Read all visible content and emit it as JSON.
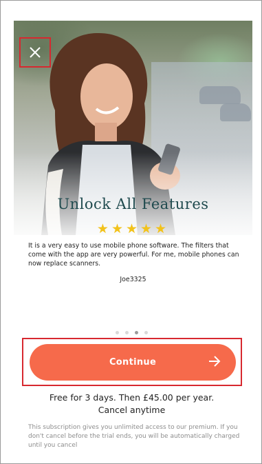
{
  "paywall": {
    "title": "Unlock All Features",
    "rating_stars": "★★★★★",
    "rating_value": 5,
    "review_text": "It is a very easy to use mobile phone software. The filters that come with the app are very powerful. For me, mobile phones can now replace scanners.",
    "review_author": "Joe3325",
    "carousel": {
      "count": 4,
      "active_index": 2
    },
    "continue_label": "Continue",
    "price_text": "Free for 3 days. Then £45.00 per year.",
    "cancel_text": "Cancel anytime",
    "fine_print": "This subscription gives you unlimited access to our premium. If you don't cancel before the trial ends, you will be automatically charged until you cancel"
  },
  "icons": {
    "close": "close-icon",
    "arrow": "arrow-right-icon",
    "star": "star-icon"
  },
  "colors": {
    "accent": "#f66a4b",
    "title": "#1f4a4e",
    "star": "#f2c21b",
    "highlight_box": "#d7282f"
  }
}
